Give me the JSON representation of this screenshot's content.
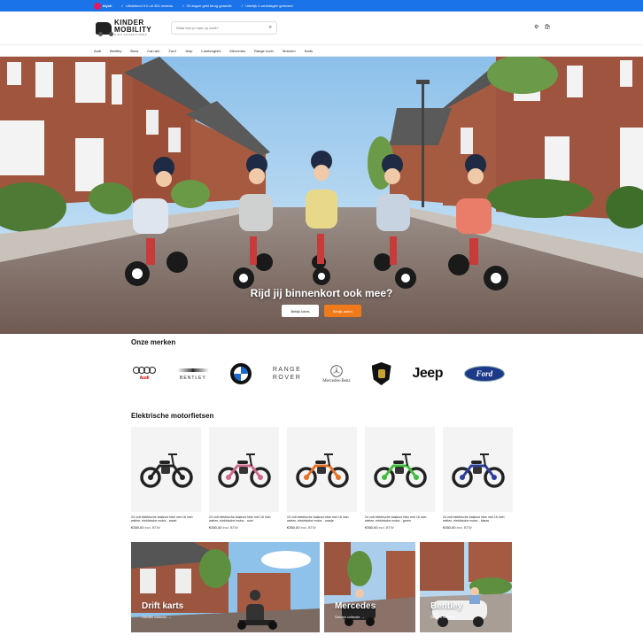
{
  "topbar": {
    "kiyoh_label": "kiyoh",
    "usps": [
      "Uitstekend 9.0 uit 324 reviews",
      "30 dagen geld terug garantie",
      "Uiterlijk 4 werkdagen geleverd"
    ]
  },
  "header": {
    "logo_main": "KINDER MOBILITY",
    "logo_sub": "KIDS ADVENTURES",
    "search_placeholder": "Waar ben je naar op zoek?"
  },
  "brandnav": {
    "items": [
      "Audi",
      "Bentley",
      "Bmw",
      "Can-am",
      "Ford",
      "Jeep",
      "Lamborghini",
      "Mercedes",
      "Range rover",
      "Motoren",
      "Karts"
    ]
  },
  "hero": {
    "title": "Rijd jij binnenkort ook mee?",
    "button_primary": "Bekijk lokes",
    "button_secondary": "Bekijk auto's"
  },
  "brands_section": {
    "title": "Onze merken",
    "audi": "Audi",
    "bentley": "BENTLEY",
    "range_rover_1": "RANGE",
    "range_rover_2": "ROVER",
    "mercedes": "Mercedes-Benz",
    "jeep": "Jeep",
    "ford": "Ford"
  },
  "products_section": {
    "title": "Elektrische motorfietsen",
    "products": [
      {
        "name": "24 volt elektrische balance bike met 16 inch wielen, elektrische motor - zwart",
        "price": "€350,00",
        "vat": "incl. BTW",
        "accent": "#222222"
      },
      {
        "name": "24 volt elektrische balance bike met 16 inch wielen, elektrische motor - roze",
        "price": "€350,00",
        "vat": "incl. BTW",
        "accent": "#d26a8a"
      },
      {
        "name": "24 volt elektrische balance bike met 16 inch wielen, elektrische motor - oranje",
        "price": "€350,00",
        "vat": "incl. BTW",
        "accent": "#e4732a"
      },
      {
        "name": "24 volt elektrische balance bike met 16 inch wielen, elektrische motor - groen",
        "price": "€350,00",
        "vat": "incl. BTW",
        "accent": "#3fbf3f"
      },
      {
        "name": "24 volt elektrische balance bike met 16 inch wielen, elektrische motor - blauw",
        "price": "€350,00",
        "vat": "incl. BTW",
        "accent": "#2b3f9e"
      }
    ]
  },
  "tiles": [
    {
      "title": "Drift karts",
      "link": "Ontdek collectie →"
    },
    {
      "title": "Mercedes",
      "link": "Ontdek collectie →"
    },
    {
      "title": "Bentley",
      "link": "Ontdek collectie →"
    }
  ]
}
